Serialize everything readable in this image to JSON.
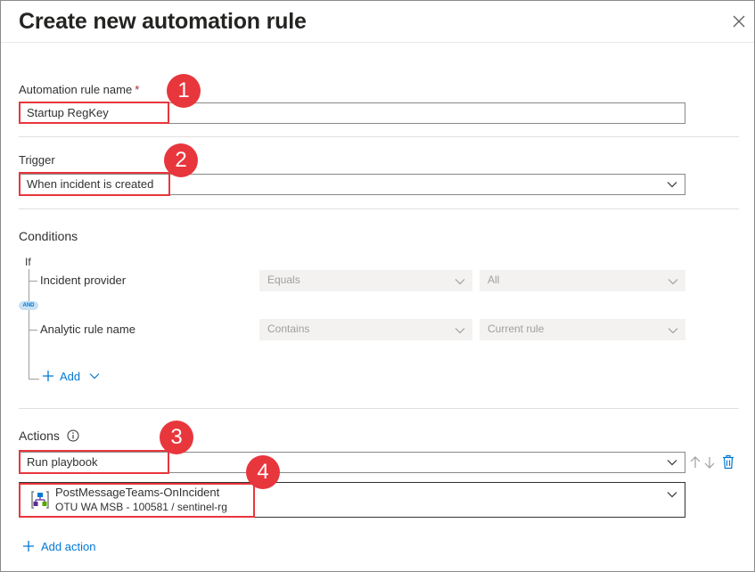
{
  "title": "Create new automation rule",
  "rule_name": {
    "label": "Automation rule name",
    "required_mark": "*",
    "value": "Startup RegKey"
  },
  "trigger": {
    "label": "Trigger",
    "value": "When incident is created"
  },
  "conditions": {
    "label": "Conditions",
    "if_label": "If",
    "and_label": "AND",
    "rows": [
      {
        "field": "Incident provider",
        "operator": "Equals",
        "value": "All"
      },
      {
        "field": "Analytic rule name",
        "operator": "Contains",
        "value": "Current rule"
      }
    ],
    "add_label": "Add"
  },
  "actions": {
    "label": "Actions",
    "action_value": "Run playbook",
    "playbook_name": "PostMessageTeams-OnIncident",
    "playbook_sub": "OTU WA MSB - 100581 / sentinel-rg",
    "add_action_label": "Add action"
  },
  "callouts": [
    "1",
    "2",
    "3",
    "4"
  ],
  "colors": {
    "accent": "#0078d4",
    "callout": "#e8363d"
  }
}
